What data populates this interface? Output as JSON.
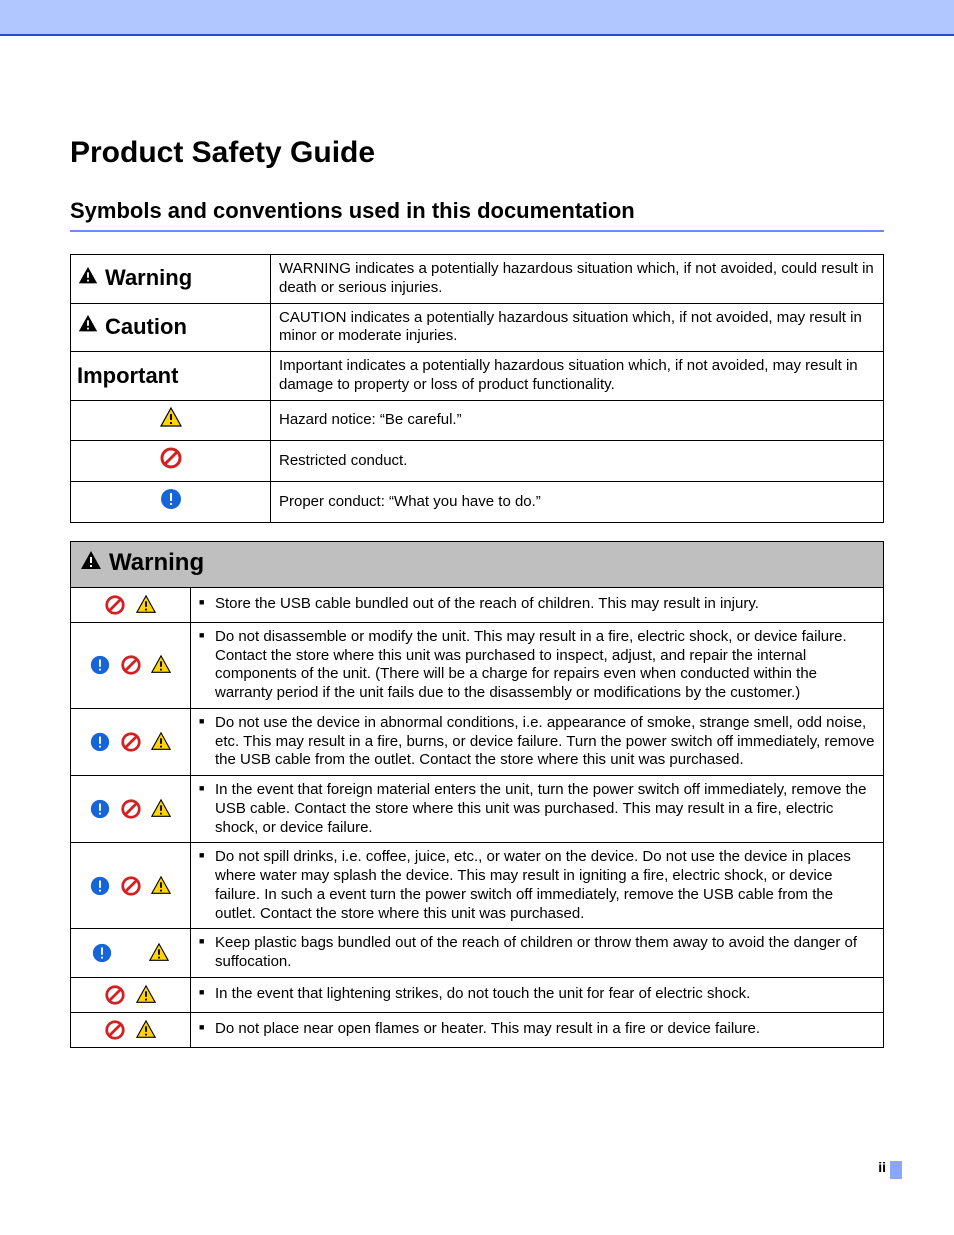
{
  "title": "Product Safety Guide",
  "subtitle": "Symbols and conventions used in this documentation",
  "symbols_table": {
    "rows": [
      {
        "label": "Warning",
        "text": "WARNING indicates a potentially hazardous situation which, if not avoided, could result in death or serious injuries."
      },
      {
        "label": "Caution",
        "text": "CAUTION indicates a potentially hazardous situation which, if not avoided, may result in minor or moderate injuries."
      },
      {
        "label": "Important",
        "text": "Important indicates a potentially hazardous situation which, if not avoided, may result in damage to property or loss of product functionality."
      },
      {
        "text": "Hazard notice: “Be careful.”"
      },
      {
        "text": "Restricted conduct."
      },
      {
        "text": "Proper conduct: “What you have to do.”"
      }
    ]
  },
  "warning_section": {
    "header": "Warning",
    "rows": [
      {
        "text": "Store the USB cable bundled out of the reach of children. This may result in injury."
      },
      {
        "text": "Do not disassemble or modify the unit. This may result in a fire, electric shock, or device failure. Contact the store where this unit was purchased to inspect, adjust, and repair the internal components of the unit. (There will be a charge for repairs even when conducted within the warranty period if the unit fails due to the disassembly or modifications by the customer.)"
      },
      {
        "text": "Do not use the device in abnormal conditions, i.e. appearance of smoke, strange smell, odd noise, etc. This may result in a fire, burns, or device failure. Turn the power switch off immediately, remove the USB cable from the outlet. Contact the store where this unit was purchased."
      },
      {
        "text": "In the event that foreign material enters the unit, turn the power switch off immediately, remove the USB cable. Contact the store where this unit was purchased. This may result in a fire, electric shock, or device failure."
      },
      {
        "text": "Do not spill drinks, i.e. coffee, juice, etc., or water on the device. Do not use the device in places where water may splash the device. This may result in igniting a fire, electric shock, or device failure. In such a event turn the power switch off immediately, remove the USB cable from the outlet. Contact the store where this unit was purchased."
      },
      {
        "text": "Keep plastic bags bundled out of the reach of children or throw them away to avoid the danger of suffocation."
      },
      {
        "text": "In the event that lightening strikes, do not touch the unit for fear of electric shock."
      },
      {
        "text": "Do not place near open flames or heater. This may result in a fire or device failure."
      }
    ]
  },
  "page_number": "ii"
}
